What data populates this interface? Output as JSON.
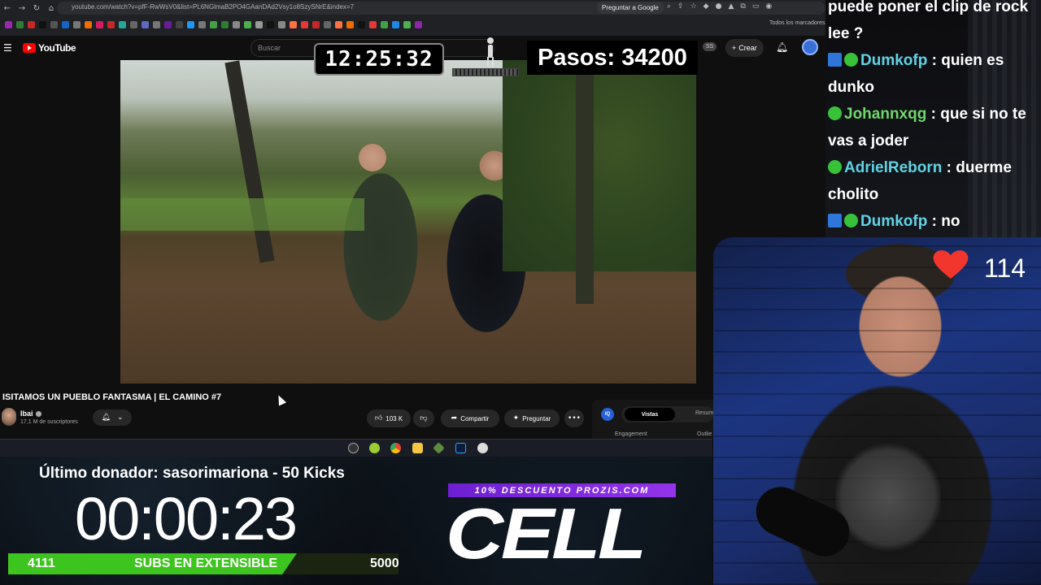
{
  "browser": {
    "url": "youtube.com/watch?v=pfF-RwWsV0&list=PL6NGlmaB2PO4GAanDAd2Vsy1o8SzySNrE&index=7",
    "ask_google": "Preguntar a Google",
    "bookmarks_folder": "Todos los marcadores"
  },
  "youtube": {
    "logo_text": "YouTube",
    "search_placeholder": "Buscar",
    "ss_badge": "SS",
    "create_label": "Crear",
    "video_title": "ISITAMOS UN PUEBLO FANTASMA | EL CAMINO #7",
    "channel_name": "Ibai",
    "subscribers": "17,1 M de suscriptores",
    "likes": "103 K",
    "share_label": "Compartir",
    "ask_label": "Preguntar",
    "panel": {
      "logo": "IQ",
      "tab_active": "Vistas",
      "tab_other": "Resum",
      "engagement": "Engagement",
      "outlie": "Outlie"
    }
  },
  "overlay": {
    "clock": "12:25:32",
    "steps": "Pasos: 34200",
    "donor": "Último donador: sasorimariona - 50 Kicks",
    "timer": "00:00:23",
    "subs_current": "4111",
    "subs_label": "SUBS EN EXTENSIBLE",
    "subs_goal": "5000",
    "subs_progress": 0.8222,
    "promo": "10% DESCUENTO PROZIS.COM",
    "brand": "CELL",
    "heart_count": "114"
  },
  "chat": [
    {
      "user": "",
      "text": "puede poner el clip de rock",
      "badges": ""
    },
    {
      "user": "",
      "text": "lee ?",
      "badges": ""
    },
    {
      "user": "Dumkofp",
      "text": ": quien es",
      "badges": "sq+round"
    },
    {
      "user": "",
      "text": "dunko",
      "badges": ""
    },
    {
      "user": "Johannxqg",
      "text": ": que si no te",
      "badges": "round"
    },
    {
      "user": "",
      "text": "vas a joder",
      "badges": ""
    },
    {
      "user": "AdrielReborn",
      "text": ": duerme",
      "badges": "round"
    },
    {
      "user": "",
      "text": "cholito",
      "badges": ""
    },
    {
      "user": "Dumkofp",
      "text": ": no",
      "badges": "sq+round"
    }
  ],
  "colors": {
    "progress_green": "#3ec41f",
    "promo_purple": "#7c22e0",
    "chat_user_cyan": "#5fd4e6",
    "chat_user_green": "#6fd66b",
    "heart_red": "#f2362e"
  },
  "icons": [
    "back-icon",
    "forward-icon",
    "reload-icon",
    "home-icon",
    "star-icon",
    "extensions-icon",
    "bell-icon",
    "like-icon",
    "dislike-icon",
    "share-icon",
    "sparkle-icon",
    "more-icon",
    "heart-icon",
    "walker-icon"
  ]
}
